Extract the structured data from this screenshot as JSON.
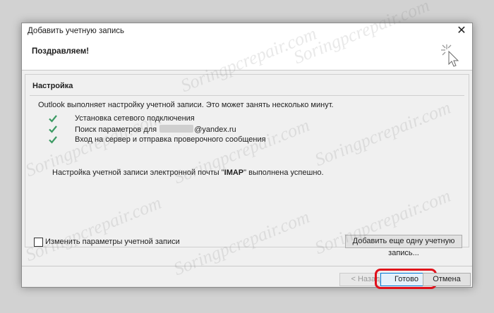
{
  "dialog": {
    "title": "Добавить учетную запись",
    "close_glyph": "✕",
    "header": "Поздравляем!",
    "section_title": "Настройка",
    "intro": "Outlook выполняет настройку учетной записи. Это может занять несколько минут.",
    "steps": [
      {
        "label": "Установка сетевого подключения",
        "status": "done"
      },
      {
        "label_prefix": "Поиск параметров для",
        "label_suffix": "@yandex.ru",
        "status": "done"
      },
      {
        "label": "Вход на сервер и отправка проверочного сообщения",
        "status": "done"
      }
    ],
    "success_prefix": "Настройка учетной записи электронной почты \"",
    "success_bold": "IMAP",
    "success_suffix": "\" выполнена успешно.",
    "change_settings": {
      "label": "Изменить параметры учетной записи",
      "checked": false
    },
    "add_another_button": "Добавить еще одну учетную запись...",
    "back_button": "< Назад",
    "done_button": "Готово",
    "cancel_button": "Отмена"
  },
  "watermark": "Soringpcrepair.com",
  "colors": {
    "check_green": "#3c9a63",
    "highlight_red": "#e0101a",
    "done_border": "#0078d7",
    "dialog_bg": "#f0f0f0"
  }
}
